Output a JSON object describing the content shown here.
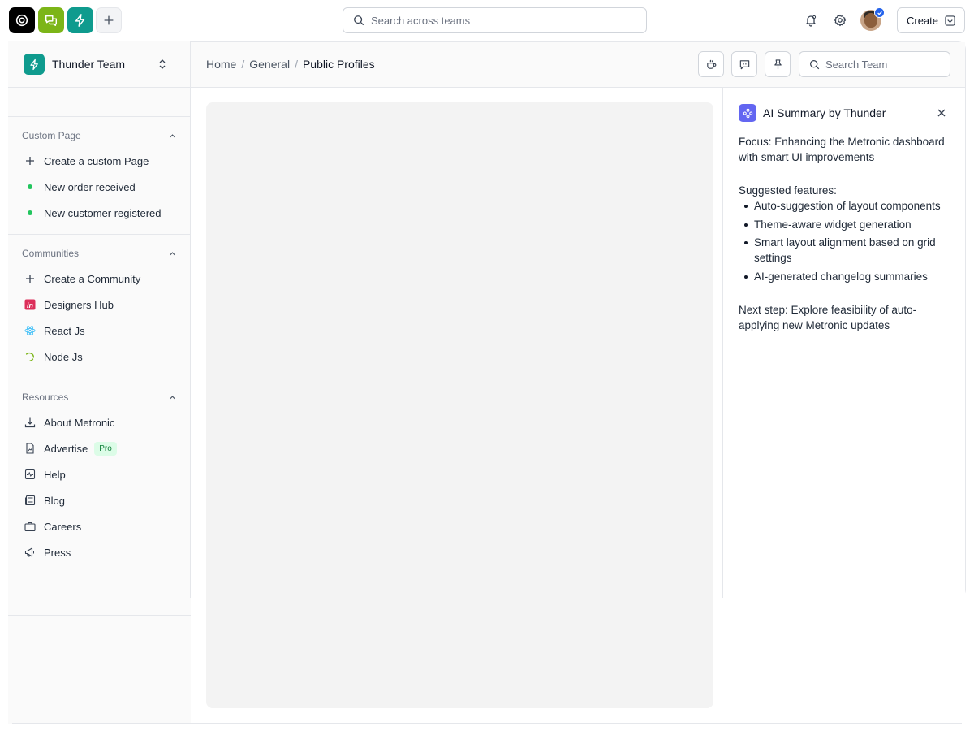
{
  "topbar": {
    "global_search_placeholder": "Search across teams",
    "create_label": "Create",
    "apps": [
      "target-app",
      "chat-app",
      "thunder-app",
      "add-app"
    ]
  },
  "sidebar": {
    "team_name": "Thunder Team",
    "sections": [
      {
        "title": "Custom Page",
        "items": [
          {
            "label": "Create a custom Page",
            "icon": "plus-icon"
          },
          {
            "label": "New order received",
            "icon": "green-dot"
          },
          {
            "label": "New customer registered",
            "icon": "green-dot"
          }
        ]
      },
      {
        "title": "Communities",
        "items": [
          {
            "label": "Create a Community",
            "icon": "plus-icon"
          },
          {
            "label": "Designers Hub",
            "icon": "invision-icon"
          },
          {
            "label": "React Js",
            "icon": "react-icon"
          },
          {
            "label": "Node Js",
            "icon": "node-icon"
          }
        ]
      },
      {
        "title": "Resources",
        "items": [
          {
            "label": "About Metronic",
            "icon": "download-icon"
          },
          {
            "label": "Advertise",
            "icon": "file-chart-icon",
            "badge": "Pro"
          },
          {
            "label": "Help",
            "icon": "pulse-icon"
          },
          {
            "label": "Blog",
            "icon": "newspaper-icon"
          },
          {
            "label": "Careers",
            "icon": "briefcase-icon"
          },
          {
            "label": "Press",
            "icon": "megaphone-icon"
          }
        ]
      }
    ]
  },
  "header": {
    "breadcrumb": [
      "Home",
      "General",
      "Public Profiles"
    ],
    "search_placeholder": "Search Team"
  },
  "ai_panel": {
    "title": "AI Summary by Thunder",
    "focus": "Focus: Enhancing the Metronic dashboard with smart UI improvements",
    "features_title": "Suggested features:",
    "features": [
      "Auto-suggestion of layout components",
      "Theme-aware widget generation",
      "Smart layout alignment based on grid settings",
      "AI-generated changelog summaries"
    ],
    "next_step": "Next step: Explore feasibility of auto-applying new Metronic updates"
  },
  "colors": {
    "thunder_teal": "#0f9b8e",
    "chat_green": "#7cb518",
    "ai_purple": "#6366f1",
    "status_green": "#22c55e"
  }
}
